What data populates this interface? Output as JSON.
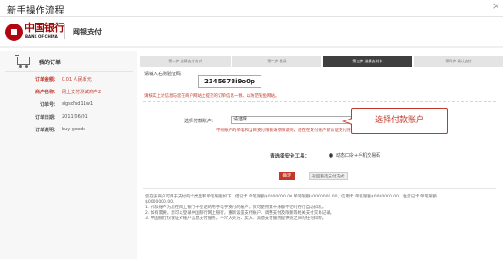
{
  "window": {
    "title": "新手操作流程"
  },
  "header": {
    "bank_name": "中国银行",
    "bank_name_en": "BANK OF CHINA",
    "product": "网银支付"
  },
  "order": {
    "title": "我的订单",
    "rows": [
      {
        "label": "订单金额：",
        "value": "0.01 人民币元",
        "highlight": true
      },
      {
        "label": "商户名称：",
        "value": "网上支付测试商户2",
        "highlight": true
      },
      {
        "label": "订单号：",
        "value": "sigsdfsd11w1",
        "highlight": false
      },
      {
        "label": "订单日期：",
        "value": "2011/06/01",
        "highlight": false
      },
      {
        "label": "订单说明：",
        "value": "buy goods",
        "highlight": false
      }
    ]
  },
  "steps": [
    "第一步 选择支付方式",
    "第二步 登录",
    "第三步 选择支付卡",
    "第四步 确认支付"
  ],
  "main": {
    "verify_label": "请输入右侧验证码：",
    "verify_code": "2345678i9o0p",
    "warning": "请核实上述信息与您在商户网站上提交的订单信息一致，以防范钓鱼网站。",
    "card_label": "选择付款账户：",
    "card_select": "请选择",
    "card_note": "不同账户的单笔和当日支付限额请参照说明，还在在支付账户前认证支付限额。",
    "callout": "选择付款账户",
    "security_label": "请选择安全工具：",
    "security_option": "动态口令+手机交易码",
    "btn_confirm": "确定",
    "btn_back": "返回重选支付方式"
  },
  "info": [
    "您在该商户可用于支付的卡类型和单笔限额如下：借记卡 单笔限额$0000000.00 单笔限额$0000000.00，信用卡 单笔限额$0000000.00，准贷记卡 单笔限额",
    "$0000000.00。",
    "1. 付款账户为您在网上银行中登记的用于电子支付的账户，仅可使用其中余额不足时在行自动扣款。",
    "2. 如有需要，您可以登录中国银行网上银行，重新设置支付账户、调整支付及限额等相关支付交易记录。",
    "3. 中国银行仅保证对账户信息支付服务，不介入买方、卖方、其他支付服务提供商之间的任何纠纷。"
  ]
}
